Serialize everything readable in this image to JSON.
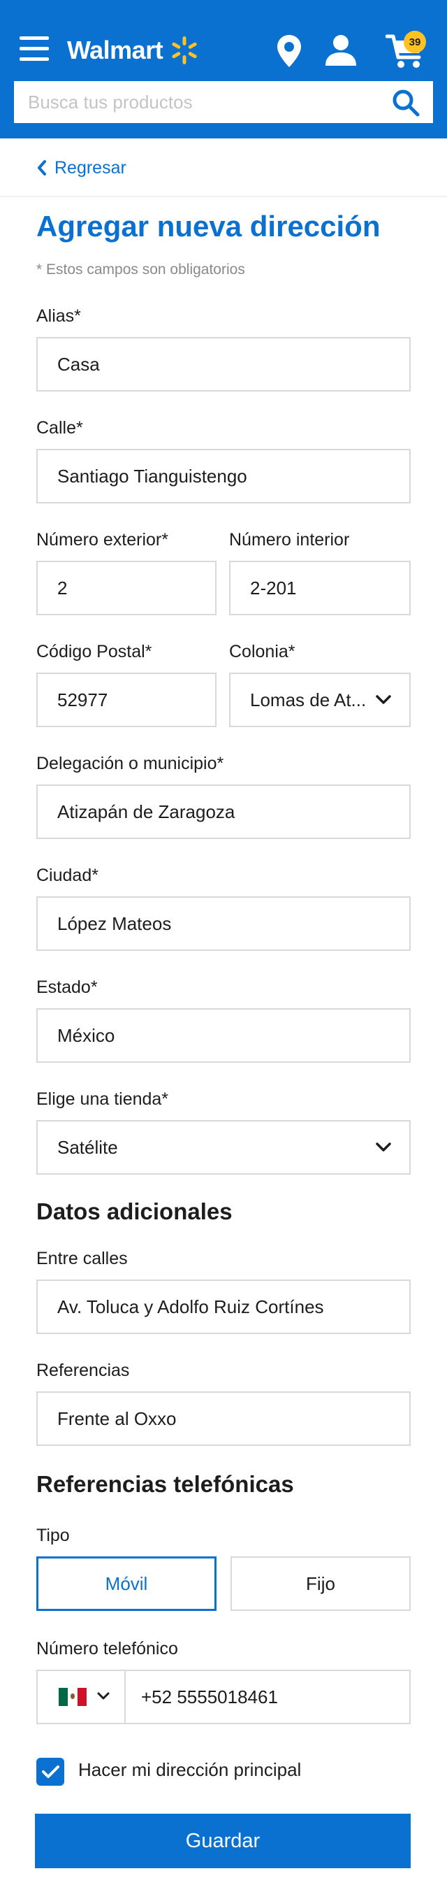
{
  "header": {
    "logo_text": "Walmart",
    "cart_count": "39",
    "search": {
      "placeholder": "Busca tus productos",
      "value": ""
    },
    "colors": {
      "brand": "#0a71d0",
      "spark": "#ffc220"
    }
  },
  "nav": {
    "back_label": "Regresar"
  },
  "form": {
    "title": "Agregar nueva dirección",
    "required_note": "* Estos campos son obligatorios",
    "alias": {
      "label": "Alias*",
      "value": "Casa"
    },
    "calle": {
      "label": "Calle*",
      "value": "Santiago Tianguistengo"
    },
    "numero_exterior": {
      "label": "Número exterior*",
      "value": "2"
    },
    "numero_interior": {
      "label": "Número interior",
      "value": "2-201"
    },
    "codigo_postal": {
      "label": "Código Postal*",
      "value": "52977"
    },
    "colonia": {
      "label": "Colonia*",
      "value": "Lomas de At..."
    },
    "municipio": {
      "label": "Delegación o municipio*",
      "value": "Atizapán de Zaragoza"
    },
    "ciudad": {
      "label": "Ciudad*",
      "value": "López Mateos"
    },
    "estado": {
      "label": "Estado*",
      "value": "México"
    },
    "tienda": {
      "label": "Elige una tienda*",
      "value": "Satélite"
    }
  },
  "additional": {
    "title": "Datos adicionales",
    "entre_calles": {
      "label": "Entre calles",
      "value": "Av. Toluca y Adolfo Ruiz Cortínes"
    },
    "referencias": {
      "label": "Referencias",
      "value": "Frente al Oxxo"
    }
  },
  "phone": {
    "title": "Referencias telefónicas",
    "tipo_label": "Tipo",
    "options": [
      {
        "label": "Móvil",
        "selected": true
      },
      {
        "label": "Fijo",
        "selected": false
      }
    ],
    "number_label": "Número telefónico",
    "country_flag": "mexico-flag-icon",
    "number_value": "+52 5555018461"
  },
  "principal": {
    "label": "Hacer mi dirección principal",
    "checked": true
  },
  "save_label": "Guardar"
}
